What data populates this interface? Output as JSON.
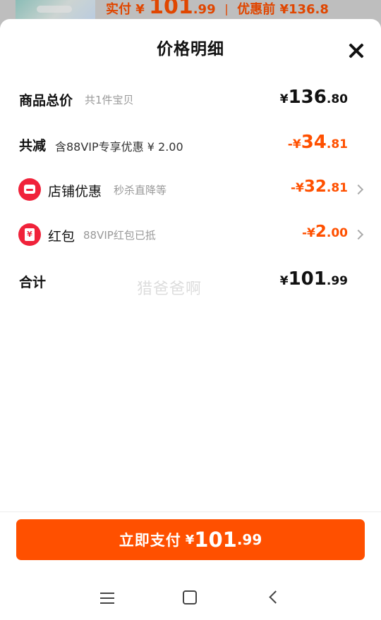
{
  "background_peek": {
    "paid_label": "实付",
    "paid_yen": "¥",
    "paid_int": "101",
    "paid_dec": ".99",
    "before_discount": "优惠前 ¥136.8"
  },
  "sheet": {
    "title": "价格明细",
    "close_icon": "close-icon"
  },
  "rows": {
    "total": {
      "label": "商品总价",
      "sub": "共1件宝贝",
      "yen": "¥",
      "int": "136",
      "dec": ".80"
    },
    "reduced": {
      "label": "共减",
      "sub": "含88VIP专享优惠 ¥ 2.00",
      "yen": "-¥",
      "int": "34",
      "dec": ".81"
    },
    "shop_discount": {
      "icon": "shop-icon",
      "label": "店铺优惠",
      "sub": "秒杀直降等",
      "yen": "-¥",
      "int": "32",
      "dec": ".81"
    },
    "red_packet": {
      "icon": "red-packet-icon",
      "label": "红包",
      "sub": "88VIP红包已抵",
      "yen": "-¥",
      "int": "2",
      "dec": ".00"
    },
    "sum": {
      "label": "合计",
      "yen": "¥",
      "int": "101",
      "dec": ".99"
    }
  },
  "watermark": "猎爸爸啊",
  "pay_button": {
    "label": "立即支付",
    "yen": "¥",
    "int": "101",
    "dec": ".99"
  },
  "colors": {
    "accent": "#ff5000",
    "icon_red": "#f0223a"
  }
}
